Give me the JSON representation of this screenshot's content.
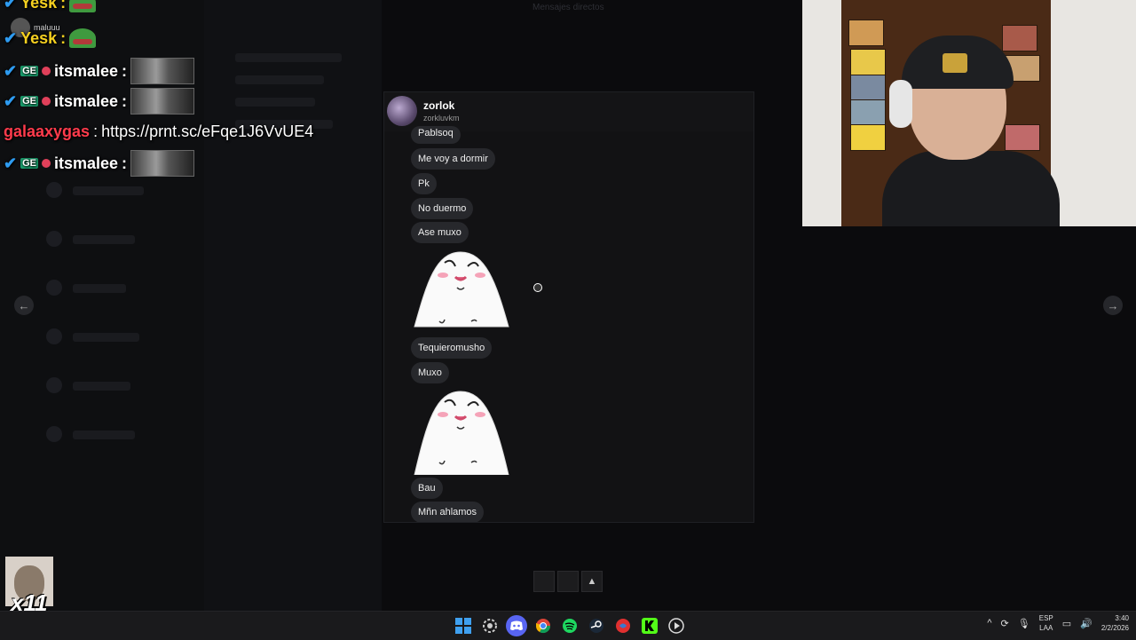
{
  "background": {
    "title": "Mensajes directos",
    "mini_user": "maluuu"
  },
  "chat": {
    "lines": [
      {
        "user": "Yesk",
        "text": ""
      },
      {
        "user": "Yesk",
        "text": ""
      },
      {
        "user": "itsmalee",
        "text": ""
      },
      {
        "user": "itsmalee",
        "text": ""
      },
      {
        "user": "galaaxygas",
        "text": "https://prnt.sc/eFqe1J6VvUE4"
      },
      {
        "user": "itsmalee",
        "text": ""
      }
    ],
    "badge_g": "GE",
    "colon": ":"
  },
  "dialog": {
    "name": "zorlok",
    "handle": "zorkluvkm",
    "messages": [
      "Pablsoq",
      "Me voy a dormir",
      "Pk",
      "No duermo",
      "Ase muxo",
      "Tequieromusho",
      "Muxo",
      "Bau",
      "Mñn ahlamos"
    ]
  },
  "nav": {
    "prev": "←",
    "next": "→"
  },
  "overlay": {
    "count": "x11"
  },
  "taskbar": {
    "apps": [
      "windows-start",
      "settings",
      "discord",
      "chrome",
      "spotify",
      "steam",
      "app-red",
      "kick",
      "media"
    ],
    "lang_top": "ESP",
    "lang_bottom": "LAA",
    "time": "3:40",
    "date": "2/2/2026"
  },
  "colors": {
    "accent_blue": "#2e9bf0",
    "chat_red_name": "#ff3b4c",
    "dialog_bg": "#121214",
    "bubble_bg": "#27282c"
  }
}
